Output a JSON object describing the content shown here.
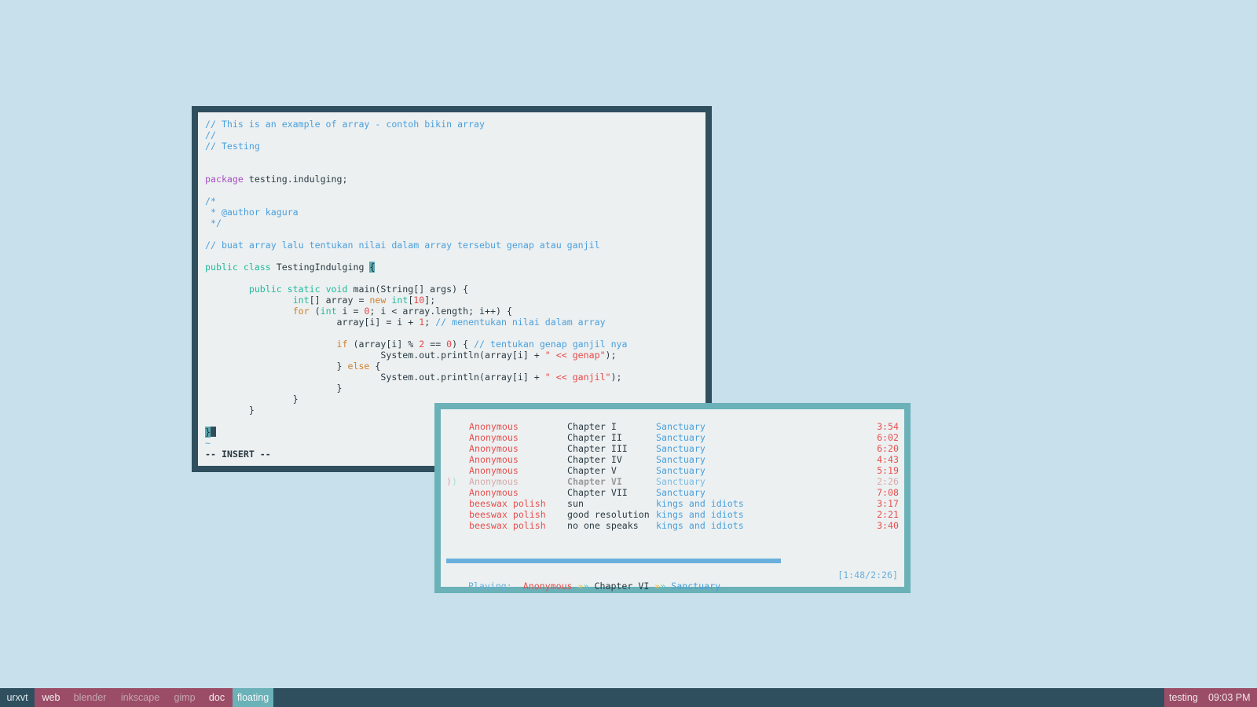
{
  "colors": {
    "desktop": "#c8dfec",
    "editor_border": "#2f4f5e",
    "player_border": "#6ab1b8",
    "workspace_active": "#9b4d67",
    "workspace_floating": "#6ab1b8"
  },
  "editor": {
    "lines": [
      [
        [
          "// This is an example of array - contoh bikin array",
          "cm"
        ]
      ],
      [
        [
          "//",
          "cm"
        ]
      ],
      [
        [
          "// Testing",
          "cm"
        ]
      ],
      [],
      [],
      [
        [
          "package",
          "kp"
        ],
        [
          " testing.indulging;",
          "tx"
        ]
      ],
      [],
      [
        [
          "/*",
          "cm"
        ]
      ],
      [
        [
          " * @author kagura",
          "cm"
        ]
      ],
      [
        [
          " */",
          "cm"
        ]
      ],
      [],
      [
        [
          "// buat array lalu tentukan nilai dalam array tersebut genap atau ganjil",
          "cm"
        ]
      ],
      [],
      [
        [
          "public class",
          "kt"
        ],
        [
          " TestingIndulging ",
          "tx"
        ],
        [
          "{",
          "cur"
        ]
      ],
      [],
      [
        [
          "        ",
          "tx"
        ],
        [
          "public static void",
          "kt"
        ],
        [
          " main(String[] args) {",
          "tx"
        ]
      ],
      [
        [
          "                ",
          "tx"
        ],
        [
          "int",
          "kt"
        ],
        [
          "[] array = ",
          "tx"
        ],
        [
          "new",
          "kc"
        ],
        [
          " ",
          "tx"
        ],
        [
          "int",
          "kt"
        ],
        [
          "[",
          "tx"
        ],
        [
          "10",
          "nu"
        ],
        [
          "];",
          "tx"
        ]
      ],
      [
        [
          "                ",
          "tx"
        ],
        [
          "for",
          "kc"
        ],
        [
          " (",
          "tx"
        ],
        [
          "int",
          "kt"
        ],
        [
          " i = ",
          "tx"
        ],
        [
          "0",
          "nu"
        ],
        [
          "; i < array.length; i++) {",
          "tx"
        ]
      ],
      [
        [
          "                        array[i] = i + ",
          "tx"
        ],
        [
          "1",
          "nu"
        ],
        [
          "; ",
          "tx"
        ],
        [
          "// menentukan nilai dalam array",
          "cm"
        ]
      ],
      [],
      [
        [
          "                        ",
          "tx"
        ],
        [
          "if",
          "kc"
        ],
        [
          " (array[i] % ",
          "tx"
        ],
        [
          "2",
          "nu"
        ],
        [
          " == ",
          "tx"
        ],
        [
          "0",
          "nu"
        ],
        [
          ") { ",
          "tx"
        ],
        [
          "// tentukan genap ganjil nya",
          "cm"
        ]
      ],
      [
        [
          "                                System.out.println(array[i] + ",
          "tx"
        ],
        [
          "\" << genap\"",
          "st"
        ],
        [
          ");",
          "tx"
        ]
      ],
      [
        [
          "                        } ",
          "tx"
        ],
        [
          "else",
          "kc"
        ],
        [
          " {",
          "tx"
        ]
      ],
      [
        [
          "                                System.out.println(array[i] + ",
          "tx"
        ],
        [
          "\" << ganjil\"",
          "st"
        ],
        [
          ");",
          "tx"
        ]
      ],
      [
        [
          "                        }",
          "tx"
        ]
      ],
      [
        [
          "                }",
          "tx"
        ]
      ],
      [
        [
          "        }",
          "tx"
        ]
      ],
      [],
      [
        [
          "}",
          "cur"
        ]
      ]
    ],
    "tilde": "~",
    "mode": "-- INSERT --"
  },
  "player": {
    "tracks": [
      {
        "artist": "Anonymous",
        "title": "Chapter I",
        "album": "Sanctuary",
        "time": "3:54"
      },
      {
        "artist": "Anonymous",
        "title": "Chapter II",
        "album": "Sanctuary",
        "time": "6:02"
      },
      {
        "artist": "Anonymous",
        "title": "Chapter III",
        "album": "Sanctuary",
        "time": "6:20"
      },
      {
        "artist": "Anonymous",
        "title": "Chapter IV",
        "album": "Sanctuary",
        "time": "4:43"
      },
      {
        "artist": "Anonymous",
        "title": "Chapter V",
        "album": "Sanctuary",
        "time": "5:19"
      },
      {
        "artist": "Anonymous",
        "title": "Chapter VI",
        "album": "Sanctuary",
        "time": "2:26",
        "playing": true
      },
      {
        "artist": "Anonymous",
        "title": "Chapter VII",
        "album": "Sanctuary",
        "time": "7:08"
      },
      {
        "artist": "beeswax polish",
        "title": "sun",
        "album": "kings and idiots",
        "time": "3:17"
      },
      {
        "artist": "beeswax polish",
        "title": "good resolution",
        "album": "kings and idiots",
        "time": "2:21"
      },
      {
        "artist": "beeswax polish",
        "title": "no one speaks",
        "album": "kings and idiots",
        "time": "3:40"
      }
    ],
    "marker_a": ")",
    "marker_b": ")",
    "progress_fraction": 0.74,
    "status": {
      "label": "Playing:",
      "artist": "Anonymous",
      "sep": "»»",
      "title": "Chapter VI",
      "album": "Sanctuary",
      "position": "[1:48/2:26]"
    }
  },
  "taskbar": {
    "workspaces": [
      {
        "label": "urxvt",
        "state": "dark"
      },
      {
        "label": "web",
        "state": "occupied"
      },
      {
        "label": "blender",
        "state": "empty"
      },
      {
        "label": "inkscape",
        "state": "empty"
      },
      {
        "label": "gimp",
        "state": "empty"
      },
      {
        "label": "doc",
        "state": "occupied"
      },
      {
        "label": "floating",
        "state": "focused"
      }
    ],
    "window_title": "testing",
    "clock": "09:03 PM"
  }
}
